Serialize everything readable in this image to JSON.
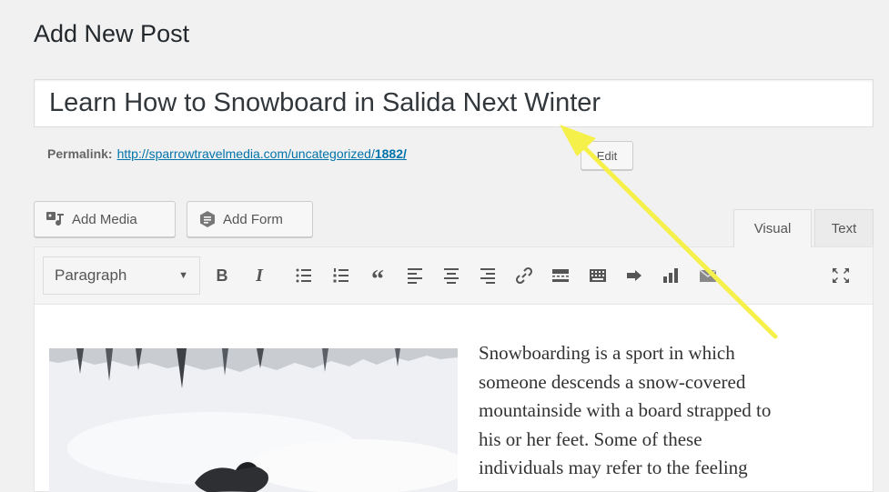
{
  "page": {
    "title": "Add New Post"
  },
  "post": {
    "title": "Learn How to Snowboard in Salida Next Winter"
  },
  "permalink": {
    "label": "Permalink:",
    "url_base": "http://sparrowtravelmedia.com/uncategorized/",
    "slug": "1882/",
    "edit_label": "Edit"
  },
  "media_buttons": {
    "add_media": "Add Media",
    "add_form": "Add Form"
  },
  "editor_tabs": {
    "visual": "Visual",
    "text": "Text",
    "active": "visual"
  },
  "toolbar": {
    "format": "Paragraph",
    "icons": [
      "bold-icon",
      "italic-icon",
      "bulleted-list-icon",
      "numbered-list-icon",
      "blockquote-icon",
      "align-left-icon",
      "align-center-icon",
      "align-right-icon",
      "link-icon",
      "read-more-icon",
      "toolbar-toggle-icon",
      "plugin-icon",
      "chart-icon",
      "mail-icon",
      "fullscreen-icon"
    ],
    "bold": "B",
    "italic": "I"
  },
  "content": {
    "lines": [
      "Snowboarding is a sport in which",
      "someone descends a snow-covered",
      "mountainside with a board strapped to",
      "his or her feet. Some of these",
      "individuals may refer to the feeling"
    ]
  },
  "colors": {
    "accent": "#0073aa",
    "arrow": "#f6f04a"
  }
}
